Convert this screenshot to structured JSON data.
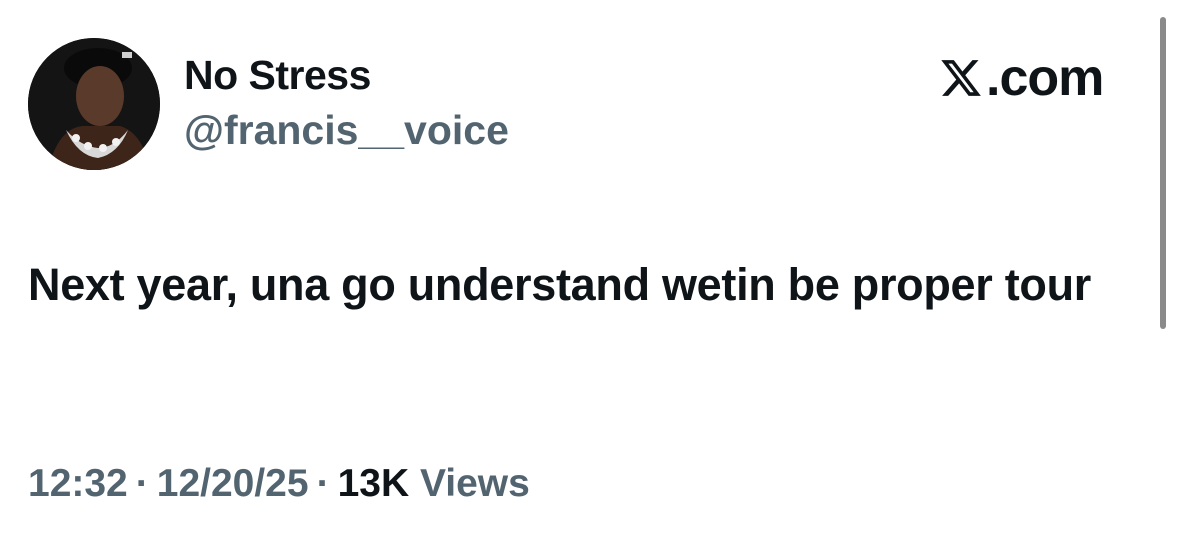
{
  "author": {
    "display_name": "No Stress",
    "handle": "@francis__voice",
    "avatar_icon": "profile-photo"
  },
  "brand": {
    "logo_icon": "x-logo-icon",
    "text": ".com"
  },
  "tweet": {
    "text": "Next year, una go understand wetin be proper tour"
  },
  "meta": {
    "time": "12:32",
    "date": "12/20/25",
    "separator": "·",
    "views_count": "13K",
    "views_label": "Views"
  },
  "colors": {
    "primary_text": "#0f1419",
    "secondary_text": "#536471",
    "background": "#ffffff"
  }
}
